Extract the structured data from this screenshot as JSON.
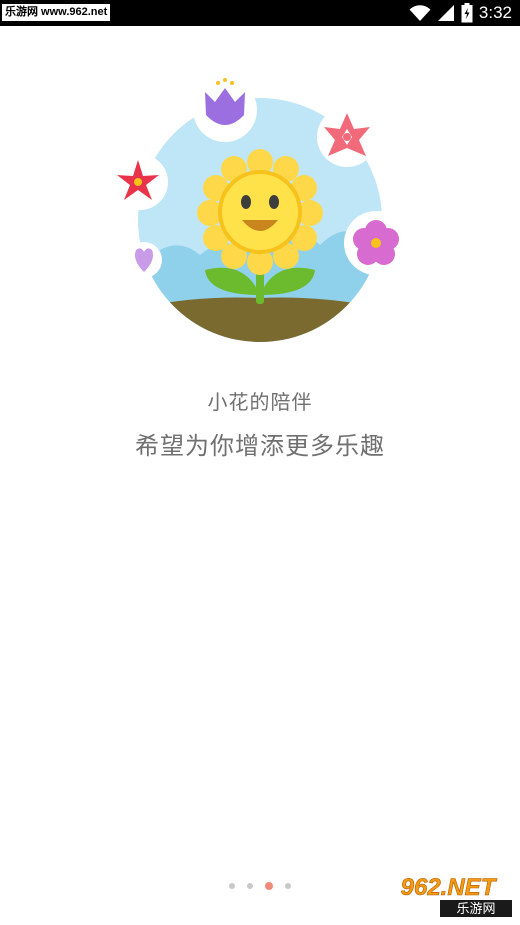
{
  "status_bar": {
    "site_badge": "乐游网 www.962.net",
    "time": "3:32",
    "icons": [
      "wifi-icon",
      "signal-icon",
      "battery-charging-icon"
    ]
  },
  "onboarding": {
    "title": "小花的陪伴",
    "subtitle": "希望为你增添更多乐趣",
    "illustration": "sunflower-illustration",
    "pager": {
      "total": 4,
      "active_index": 2
    }
  },
  "watermark": {
    "top_text": "962.NET",
    "bottom_text": "乐游网"
  },
  "colors": {
    "text": "#707070",
    "active_dot": "#f08a78",
    "inactive_dot": "#c8c8c8",
    "sky": "#bfe6f7",
    "sun_petal": "#ffd84a",
    "leaf": "#6cba2e",
    "soil": "#7a6a2f"
  }
}
